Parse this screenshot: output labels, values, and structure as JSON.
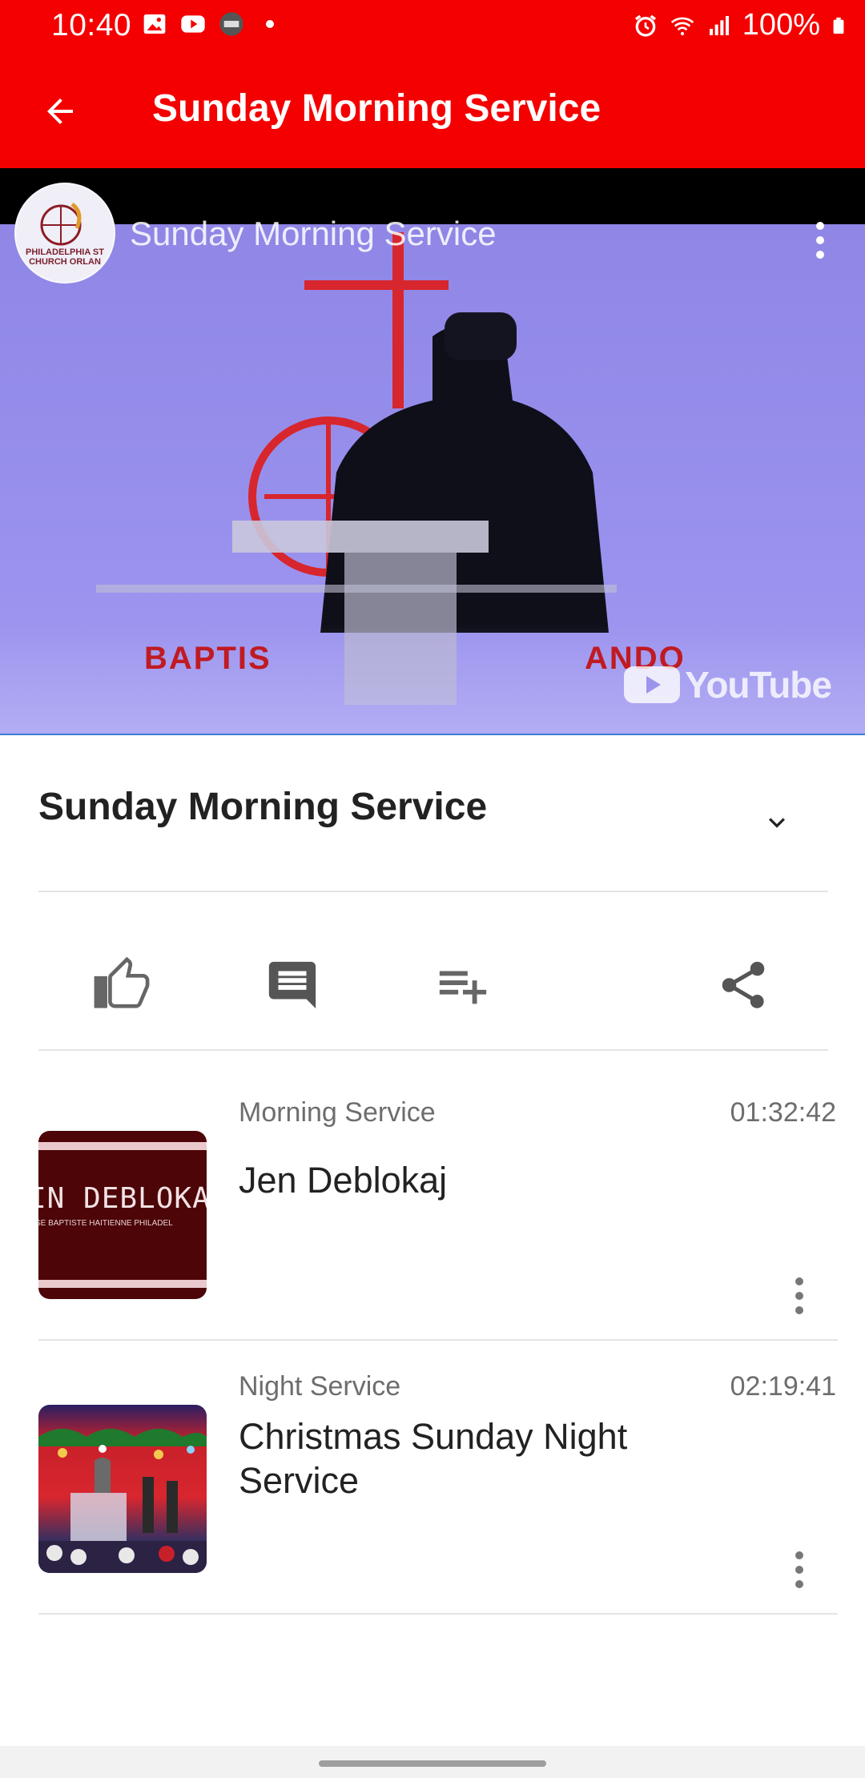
{
  "status_bar": {
    "time": "10:40",
    "battery": "100%",
    "left_icons": [
      "image-icon",
      "youtube-icon",
      "app-badge-icon",
      "dot"
    ],
    "right_icons": [
      "alarm-icon",
      "wifi-icon",
      "signal-icon",
      "battery-icon"
    ]
  },
  "app_bar": {
    "title": "Sunday Morning Service",
    "background_color": "#f50000"
  },
  "player": {
    "overlay_title": "Sunday Morning Service",
    "channel_avatar_text": "PHILADELPHIA ST CHURCH ORLAN",
    "stage_text_left": "BAPTIS",
    "stage_text_right": "ANDO",
    "brand": "YouTube"
  },
  "details": {
    "title": "Sunday Morning Service"
  },
  "actions": [
    {
      "name": "like",
      "icon": "thumbs-up-icon"
    },
    {
      "name": "comment",
      "icon": "comment-icon"
    },
    {
      "name": "add-to-playlist",
      "icon": "playlist-add-icon"
    },
    {
      "name": "share",
      "icon": "share-icon"
    }
  ],
  "videos": [
    {
      "category": "Morning Service",
      "duration": "01:32:42",
      "title": "Jen Deblokaj",
      "thumbnail_text": "IN DEBLOKA",
      "thumbnail_subtext": "SE BAPTISTE HAITIENNE PHILADEL"
    },
    {
      "category": "Night Service",
      "duration": "02:19:41",
      "title": "Christmas Sunday Night Service"
    }
  ]
}
